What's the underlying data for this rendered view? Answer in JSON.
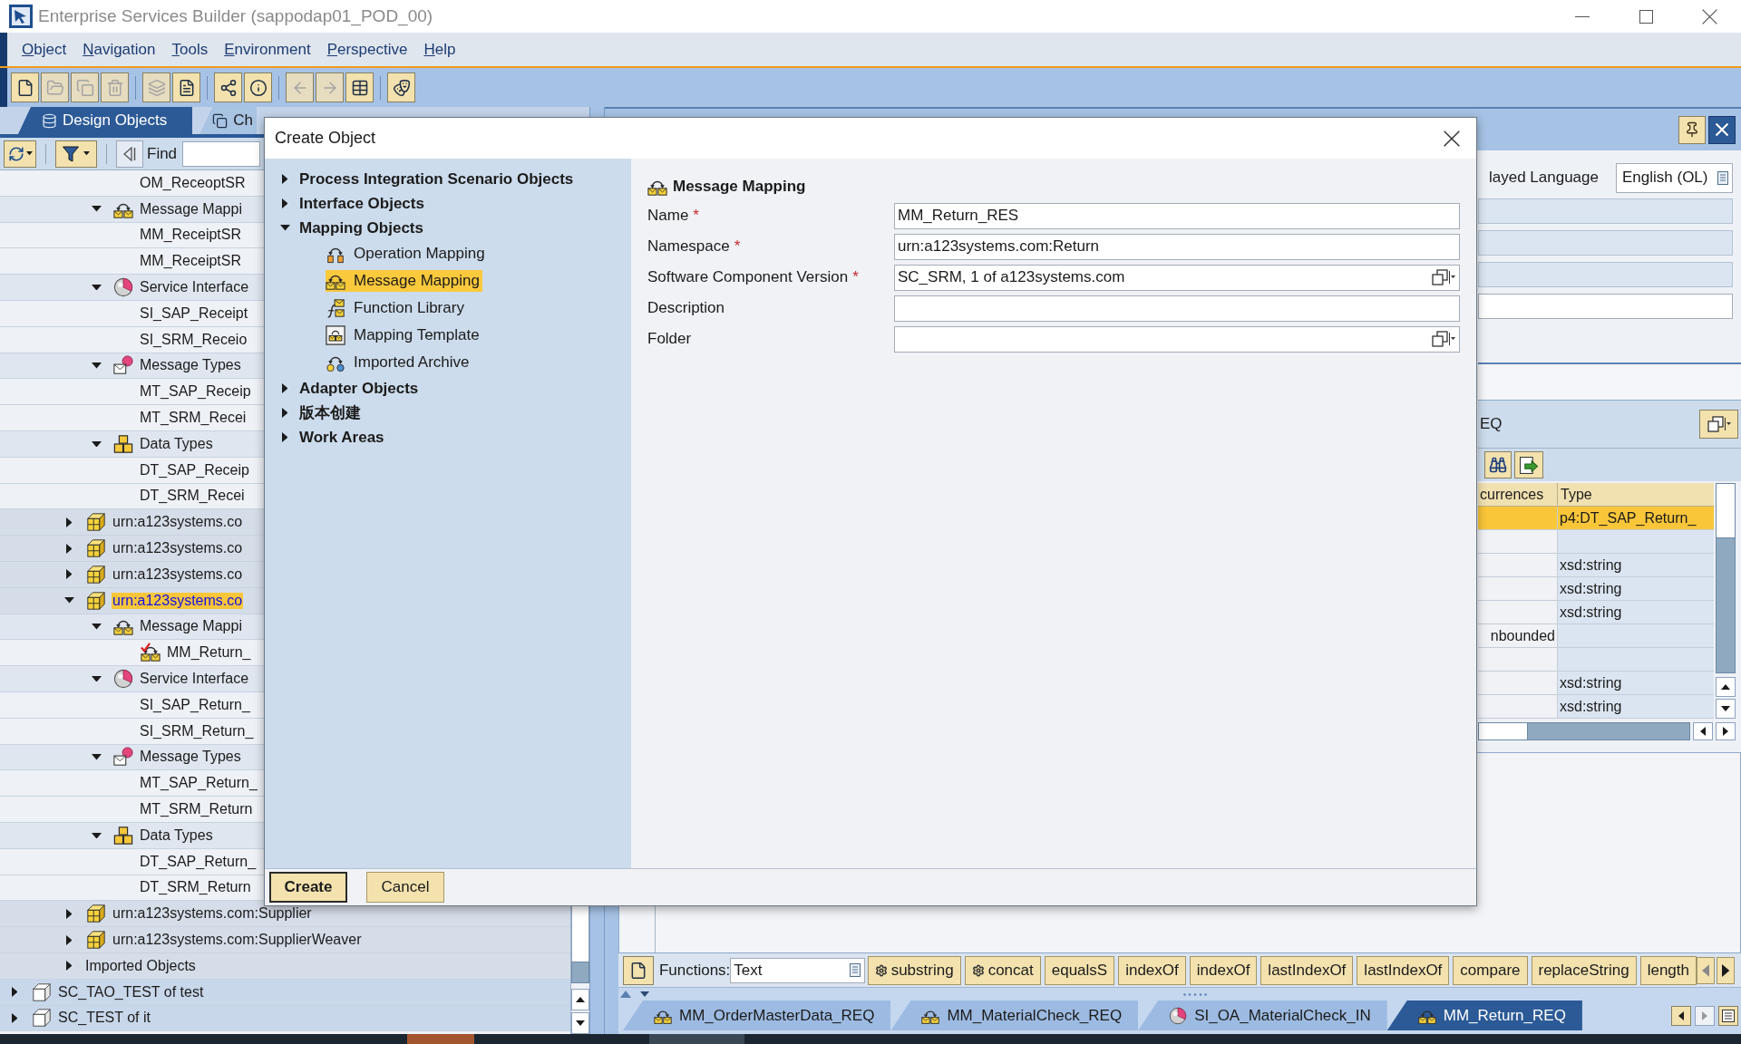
{
  "window": {
    "title": "Enterprise Services Builder (sappodap01_POD_00)"
  },
  "menu": [
    "Object",
    "Navigation",
    "Tools",
    "Environment",
    "Perspective",
    "Help"
  ],
  "toolbar": {
    "groups": [
      {
        "buttons": [
          {
            "disabled": false
          },
          {
            "disabled": true
          },
          {
            "disabled": true
          },
          {
            "disabled": true
          }
        ]
      },
      {
        "buttons": [
          {
            "disabled": true
          },
          {
            "disabled": false
          }
        ]
      },
      {
        "buttons": [
          {
            "disabled": false
          },
          {
            "disabled": false
          }
        ]
      },
      {
        "buttons": [
          {
            "disabled": true
          },
          {
            "disabled": true
          },
          {
            "disabled": false
          }
        ]
      },
      {
        "buttons": [
          {
            "disabled": false
          }
        ]
      }
    ]
  },
  "left_panel": {
    "tabs": [
      {
        "label": "Design Objects",
        "selected": true
      },
      {
        "label": "Ch",
        "selected": false
      }
    ],
    "find": {
      "label": "Find"
    },
    "tree": [
      {
        "children": [
          {
            "children": [
              {
                "children": [
                  {
                    "children": [
                      {
                        "label": "OM_ReceoptSR",
                        "selected": false
                      }
                    ]
                  },
                  {
                    "label": "Message Mappi",
                    "kind": "message_mapping",
                    "expanded": true,
                    "selected": false,
                    "children": [
                      {
                        "label": "MM_ReceiptSR",
                        "selected": false
                      },
                      {
                        "label": "MM_ReceiptSR",
                        "selected": false
                      }
                    ]
                  },
                  {
                    "label": "Service Interface",
                    "kind": "service_interface",
                    "expanded": true,
                    "selected": false,
                    "children": [
                      {
                        "label": "SI_SAP_Receipt",
                        "selected": false
                      },
                      {
                        "label": "SI_SRM_Receio",
                        "selected": false
                      }
                    ]
                  },
                  {
                    "label": "Message Types",
                    "kind": "message_type",
                    "expanded": true,
                    "selected": false,
                    "children": [
                      {
                        "label": "MT_SAP_Receip",
                        "selected": false
                      },
                      {
                        "label": "MT_SRM_Recei",
                        "selected": false
                      }
                    ]
                  },
                  {
                    "label": "Data Types",
                    "kind": "data_type",
                    "expanded": true,
                    "selected": false,
                    "children": [
                      {
                        "label": "DT_SAP_Receip",
                        "selected": false
                      },
                      {
                        "label": "DT_SRM_Recei",
                        "selected": false
                      }
                    ]
                  }
                ]
              },
              {
                "label": "urn:a123systems.co",
                "kind": "namespace",
                "expanded": false,
                "selected": false
              },
              {
                "label": "urn:a123systems.co",
                "kind": "namespace",
                "expanded": false,
                "selected": false
              },
              {
                "label": "urn:a123systems.co",
                "kind": "namespace",
                "expanded": false,
                "selected": false
              },
              {
                "label": "urn:a123systems.co",
                "kind": "namespace",
                "expanded": true,
                "selected": true,
                "children": [
                  {
                    "label": "Message Mappi",
                    "kind": "message_mapping",
                    "expanded": true,
                    "selected": false,
                    "children": [
                      {
                        "label": "MM_Return_",
                        "kind": "message_mapping_edited",
                        "selected": false
                      }
                    ]
                  },
                  {
                    "label": "Service Interface",
                    "kind": "service_interface",
                    "expanded": true,
                    "selected": false,
                    "children": [
                      {
                        "label": "SI_SAP_Return_",
                        "selected": false
                      },
                      {
                        "label": "SI_SRM_Return_",
                        "selected": false
                      }
                    ]
                  },
                  {
                    "label": "Message Types",
                    "kind": "message_type",
                    "expanded": true,
                    "selected": false,
                    "children": [
                      {
                        "label": "MT_SAP_Return_",
                        "selected": false
                      },
                      {
                        "label": "MT_SRM_Return",
                        "selected": false
                      }
                    ]
                  },
                  {
                    "label": "Data Types",
                    "kind": "data_type",
                    "expanded": true,
                    "selected": false,
                    "children": [
                      {
                        "label": "DT_SAP_Return_",
                        "selected": false
                      },
                      {
                        "label": "DT_SRM_Return",
                        "selected": false
                      }
                    ]
                  }
                ]
              },
              {
                "label": "urn:a123systems.com:Supplier",
                "kind": "namespace",
                "expanded": false,
                "selected": false
              },
              {
                "label": "urn:a123systems.com:SupplierWeaver",
                "kind": "namespace",
                "expanded": false,
                "selected": false
              },
              {
                "label": "Imported Objects",
                "expanded": false,
                "selected": false
              }
            ]
          }
        ]
      },
      {
        "label": "SC_TAO_TEST of test",
        "kind": "software_component",
        "expanded": false,
        "selected": false
      },
      {
        "label": "SC_TEST of it",
        "kind": "software_component",
        "expanded": false,
        "selected": false
      }
    ]
  },
  "dialog": {
    "title": "Create Object",
    "categories": [
      {
        "label": "Process Integration Scenario Objects",
        "expanded": false,
        "selected": false
      },
      {
        "label": "Interface Objects",
        "expanded": false,
        "selected": false
      },
      {
        "label": "Mapping Objects",
        "expanded": true,
        "selected": false,
        "children": [
          {
            "label": "Operation Mapping",
            "kind": "operation_mapping",
            "selected": false
          },
          {
            "label": "Message Mapping",
            "kind": "message_mapping",
            "selected": true
          },
          {
            "label": "Function Library",
            "kind": "function_library",
            "selected": false
          },
          {
            "label": "Mapping Template",
            "kind": "mapping_template",
            "selected": false
          },
          {
            "label": "Imported Archive",
            "kind": "imported_archive",
            "selected": false
          }
        ]
      },
      {
        "label": "Adapter Objects",
        "expanded": false,
        "selected": false
      },
      {
        "label": "版本创建",
        "expanded": false,
        "selected": false
      },
      {
        "label": "Work Areas",
        "expanded": false,
        "selected": false
      }
    ],
    "form": {
      "kind": "message_mapping",
      "heading": "Message Mapping",
      "fields": [
        {
          "label": "Name",
          "required_mark": "*",
          "kind": "text",
          "value": "MM_Return_RES"
        },
        {
          "label": "Namespace",
          "required_mark": "*",
          "kind": "text",
          "value": "urn:a123systems.com:Return"
        },
        {
          "label": "Software Component Version",
          "required_mark": "*",
          "kind": "select",
          "value": "SC_SRM, 1 of a123systems.com"
        },
        {
          "label": "Description",
          "kind": "text"
        },
        {
          "label": "Folder",
          "kind": "select"
        }
      ]
    },
    "buttons": [
      {
        "label": "Create",
        "default": true
      },
      {
        "label": "Cancel",
        "default": false
      }
    ]
  },
  "details_panel": {
    "language": {
      "label": "layed Language",
      "value": "English (OL)"
    },
    "fields": [
      {
        "disabled": true
      },
      {
        "disabled": true
      },
      {
        "disabled": true
      },
      {
        "disabled": false
      }
    ],
    "structure": {
      "title": "EQ",
      "columns": [
        {
          "label": "currences"
        },
        {
          "label": "Type"
        }
      ],
      "rows": [
        {
          "type": "p4:DT_SAP_Return_",
          "selected": true
        },
        {
          "selected": false
        },
        {
          "type": "xsd:string",
          "selected": false
        },
        {
          "type": "xsd:string",
          "selected": false
        },
        {
          "type": "xsd:string",
          "selected": false
        },
        {
          "column_1": "nbounded",
          "selected": false
        },
        {
          "selected": false
        },
        {
          "type": "xsd:string",
          "selected": false
        },
        {
          "type": "xsd:string",
          "selected": false
        }
      ]
    }
  },
  "functions_bar": {
    "label": "Functions:",
    "category": "Text",
    "functions": [
      {
        "label": "substring",
        "kind": "configurable"
      },
      {
        "label": "concat",
        "kind": "configurable"
      },
      {
        "label": "equalsS",
        "kind": "plain"
      },
      {
        "label": "indexOf",
        "kind": "plain"
      },
      {
        "label": "indexOf",
        "kind": "plain"
      },
      {
        "label": "lastIndexOf",
        "kind": "plain"
      },
      {
        "label": "lastIndexOf",
        "kind": "plain"
      },
      {
        "label": "compare",
        "kind": "plain"
      },
      {
        "label": "replaceString",
        "kind": "plain"
      },
      {
        "label": "length",
        "kind": "plain"
      }
    ]
  },
  "editor_tabs": [
    {
      "label": "MM_OrderMasterData_REQ",
      "kind": "message_mapping",
      "selected": false
    },
    {
      "label": "MM_MaterialCheck_REQ",
      "kind": "message_mapping",
      "selected": false
    },
    {
      "label": "SI_OA_MaterialCheck_IN",
      "kind": "service_interface",
      "selected": false
    },
    {
      "label": "MM_Return_REQ",
      "kind": "message_mapping",
      "selected": true
    }
  ]
}
